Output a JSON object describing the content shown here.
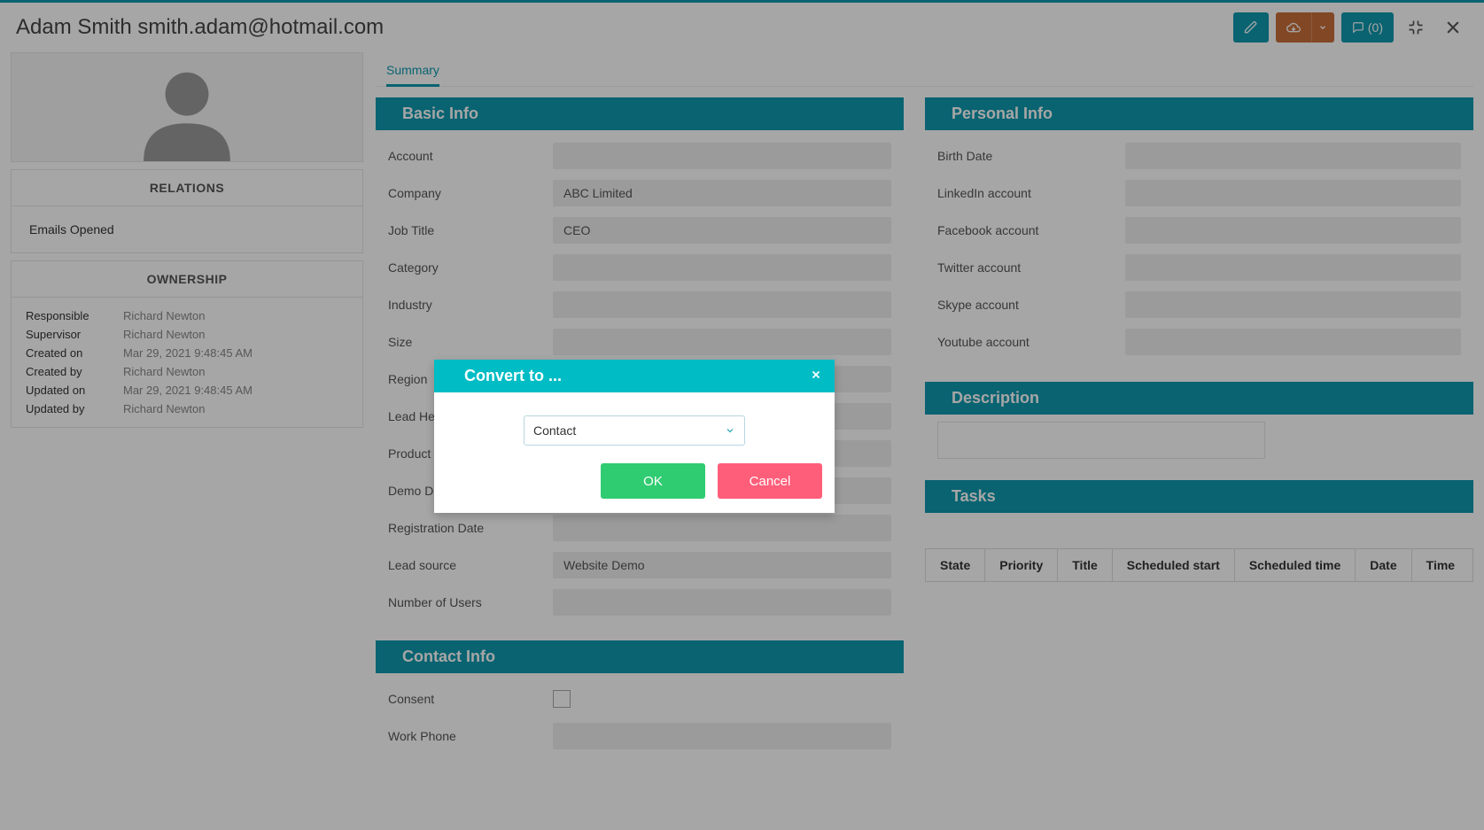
{
  "header": {
    "title": "Adam Smith smith.adam@hotmail.com",
    "comments_label": "(0)"
  },
  "sidebar": {
    "relations_title": "RELATIONS",
    "relations_item": "Emails Opened",
    "ownership_title": "OWNERSHIP",
    "ownership": [
      {
        "label": "Responsible",
        "value": "Richard Newton"
      },
      {
        "label": "Supervisor",
        "value": "Richard Newton"
      },
      {
        "label": "Created on",
        "value": "Mar 29, 2021 9:48:45 AM"
      },
      {
        "label": "Created by",
        "value": "Richard Newton"
      },
      {
        "label": "Updated on",
        "value": "Mar 29, 2021 9:48:45 AM"
      },
      {
        "label": "Updated by",
        "value": "Richard Newton"
      }
    ]
  },
  "tabs": {
    "summary": "Summary"
  },
  "basic_info": {
    "title": "Basic Info",
    "fields": [
      {
        "label": "Account",
        "value": ""
      },
      {
        "label": "Company",
        "value": "ABC Limited"
      },
      {
        "label": "Job Title",
        "value": "CEO"
      },
      {
        "label": "Category",
        "value": ""
      },
      {
        "label": "Industry",
        "value": ""
      },
      {
        "label": "Size",
        "value": ""
      },
      {
        "label": "Region",
        "value": ""
      },
      {
        "label": "Lead Health",
        "value": ""
      },
      {
        "label": "Product",
        "value": ""
      },
      {
        "label": "Demo Date",
        "value": ""
      },
      {
        "label": "Registration Date",
        "value": ""
      },
      {
        "label": "Lead source",
        "value": "Website Demo"
      },
      {
        "label": "Number of Users",
        "value": ""
      }
    ]
  },
  "contact_info": {
    "title": "Contact Info",
    "consent_label": "Consent",
    "work_phone_label": "Work Phone",
    "work_phone_value": ""
  },
  "personal_info": {
    "title": "Personal Info",
    "fields": [
      {
        "label": "Birth Date",
        "value": ""
      },
      {
        "label": "LinkedIn account",
        "value": ""
      },
      {
        "label": "Facebook account",
        "value": ""
      },
      {
        "label": "Twitter account",
        "value": ""
      },
      {
        "label": "Skype account",
        "value": ""
      },
      {
        "label": "Youtube account",
        "value": ""
      }
    ]
  },
  "description": {
    "title": "Description"
  },
  "tasks": {
    "title": "Tasks",
    "columns": [
      "State",
      "Priority",
      "Title",
      "Scheduled start",
      "Scheduled time",
      "Date",
      "Time"
    ]
  },
  "modal": {
    "title": "Convert to ...",
    "select_value": "Contact",
    "ok": "OK",
    "cancel": "Cancel"
  }
}
